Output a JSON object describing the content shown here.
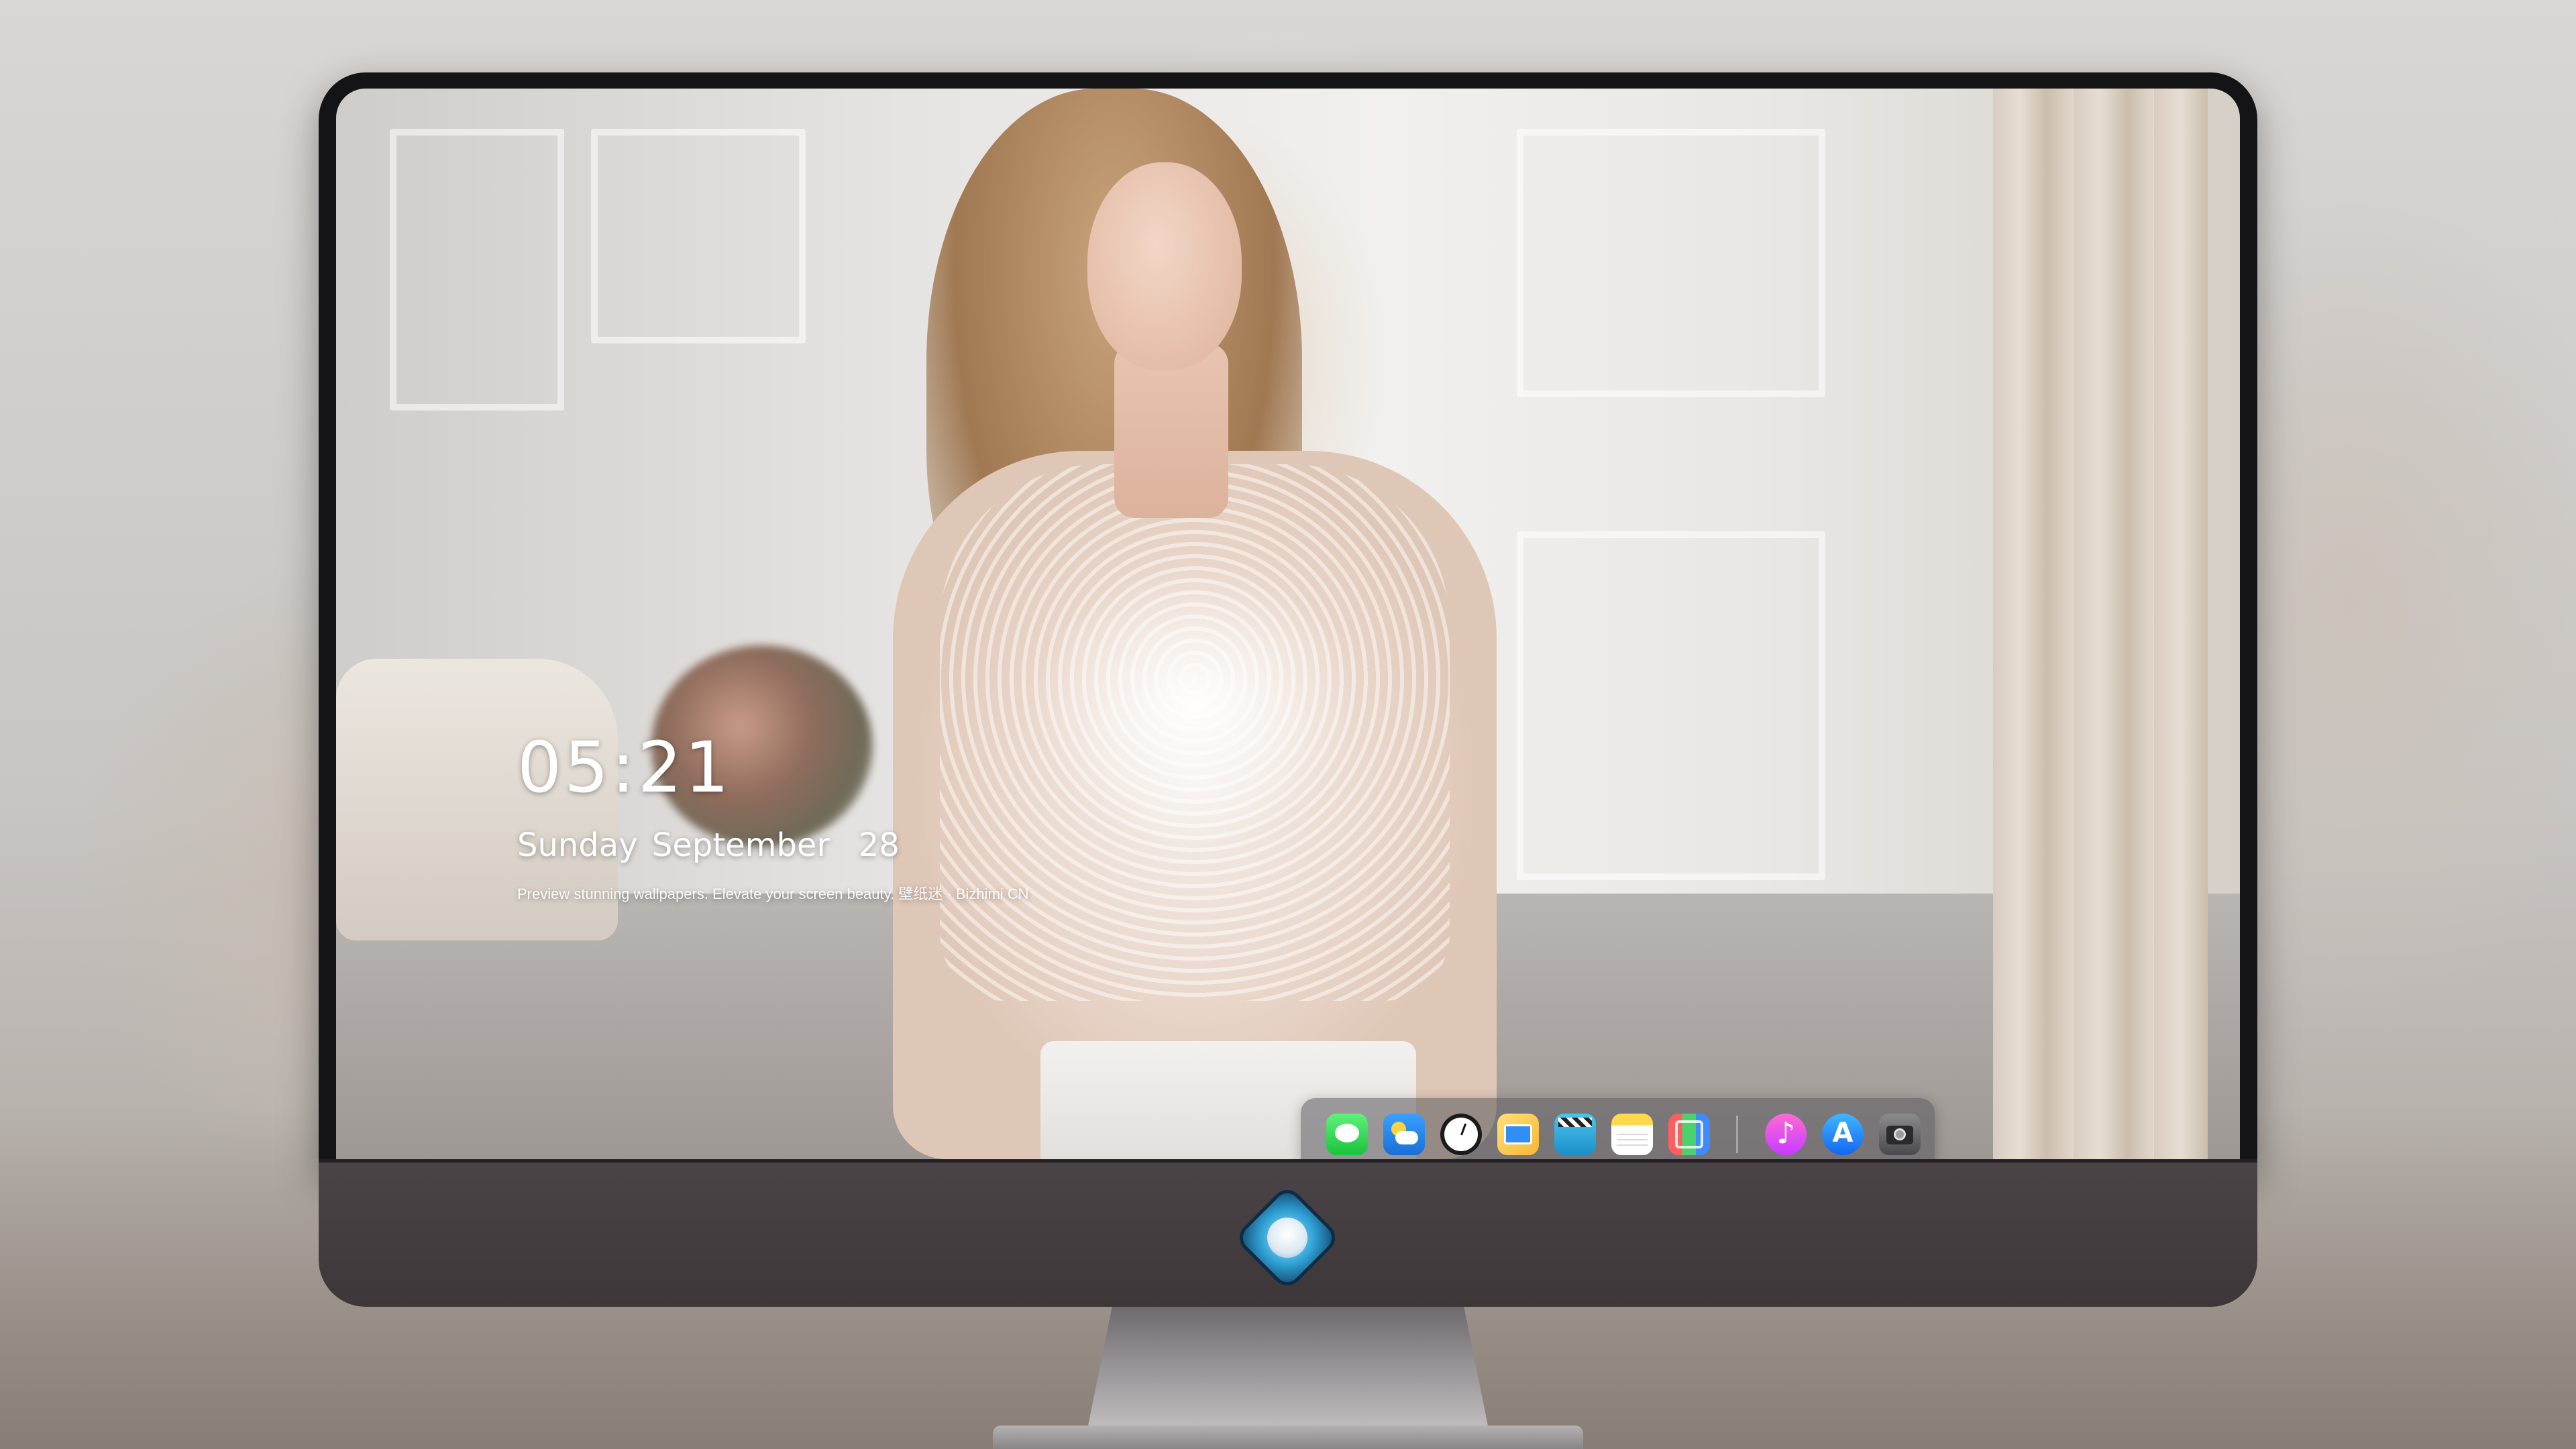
{
  "lock_screen": {
    "time": "05:21",
    "date": "Sunday September  28",
    "tagline": "Preview stunning wallpapers. Elevate your screen beauty. 壁纸迷 · Bizhimi CN"
  },
  "dock": {
    "apps": [
      {
        "name": "Messages",
        "icon": "messages-icon"
      },
      {
        "name": "Weather",
        "icon": "weather-icon"
      },
      {
        "name": "Clock",
        "icon": "clock-icon"
      },
      {
        "name": "Finder",
        "icon": "finder-icon"
      },
      {
        "name": "Clips",
        "icon": "clips-icon"
      },
      {
        "name": "Notes",
        "icon": "notes-icon"
      },
      {
        "name": "Photos",
        "icon": "photos-icon"
      },
      {
        "name": "Music",
        "icon": "music-icon"
      },
      {
        "name": "App Store",
        "icon": "app-store-icon"
      },
      {
        "name": "Camera",
        "icon": "camera-icon"
      }
    ]
  },
  "monitor": {
    "logo_icon": "dragon-mascot-icon"
  },
  "colors": {
    "bezel": "#141416",
    "chin": "#4a4447",
    "dock_background": "#5a585c",
    "clock_text": "#ffffff"
  }
}
